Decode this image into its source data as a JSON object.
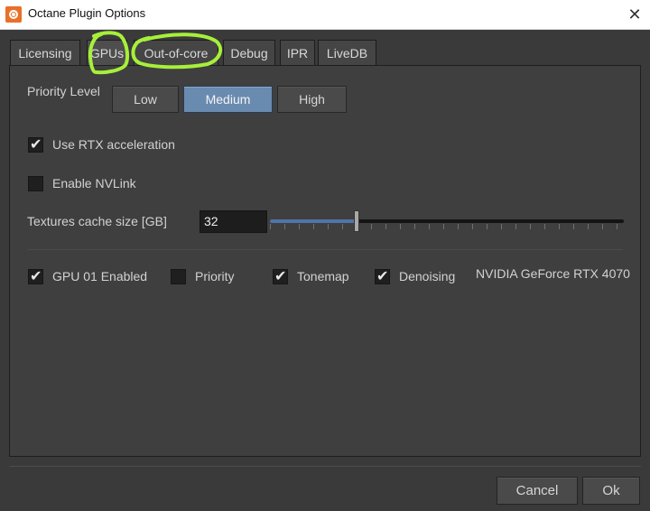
{
  "window": {
    "title": "Octane Plugin Options",
    "close_symbol": "✕"
  },
  "tabs": [
    {
      "label": "Licensing"
    },
    {
      "label": "GPUs"
    },
    {
      "label": "Out-of-core"
    },
    {
      "label": "Debug"
    },
    {
      "label": "IPR"
    },
    {
      "label": "LiveDB"
    }
  ],
  "active_tab": "GPUs",
  "priority": {
    "label": "Priority Level",
    "options": [
      "Low",
      "Medium",
      "High"
    ],
    "selected": "Medium"
  },
  "rtx": {
    "label": "Use RTX acceleration",
    "checked": true
  },
  "nvlink": {
    "label": "Enable NVLink",
    "checked": false
  },
  "texture_cache": {
    "label": "Textures cache size [GB]",
    "value": "32",
    "slider_fraction": 0.245
  },
  "gpu": {
    "enabled_label": "GPU 01 Enabled",
    "enabled": true,
    "priority_label": "Priority",
    "priority": false,
    "tonemap_label": "Tonemap",
    "tonemap": true,
    "denoising_label": "Denoising",
    "denoising": true,
    "name": "NVIDIA GeForce RTX 4070"
  },
  "footer": {
    "cancel_label": "Cancel",
    "ok_label": "Ok"
  },
  "colors": {
    "annotation": "#a6f03a",
    "selected_button": "#6a8bb0",
    "slider_fill": "#4f75a8"
  }
}
